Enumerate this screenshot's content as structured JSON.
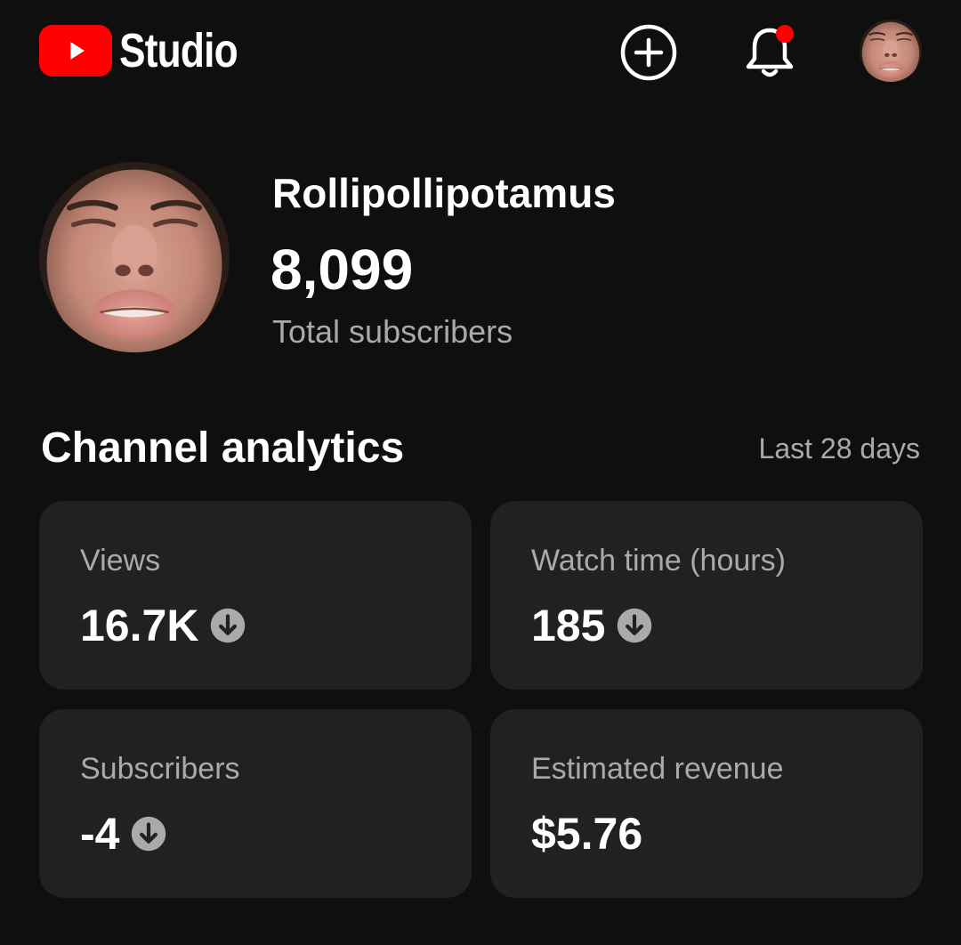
{
  "header": {
    "logo_text": "Studio",
    "brand_color": "#ff0000",
    "icons": [
      "youtube-play-icon",
      "create-icon",
      "notifications-icon",
      "account-avatar"
    ],
    "has_notification_dot": true
  },
  "channel": {
    "name": "Rollipollipotamus",
    "subscriber_count": "8,099",
    "subscriber_label": "Total subscribers"
  },
  "analytics": {
    "title": "Channel analytics",
    "period": "Last 28 days",
    "cards": [
      {
        "label": "Views",
        "value": "16.7K",
        "trend": "down"
      },
      {
        "label": "Watch time (hours)",
        "value": "185",
        "trend": "down"
      },
      {
        "label": "Subscribers",
        "value": "-4",
        "trend": "down"
      },
      {
        "label": "Estimated revenue",
        "value": "$5.76",
        "trend": "none"
      }
    ]
  },
  "colors": {
    "background": "#0f0f0f",
    "card": "#212121",
    "secondary_text": "#aaaaaa",
    "trend_icon": "#aaaaaa"
  }
}
